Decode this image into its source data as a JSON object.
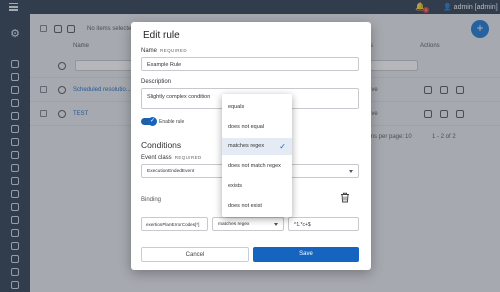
{
  "topbar": {
    "user_label": "admin [admin]",
    "notification_count": "1"
  },
  "background": {
    "selection_text": "No items selected",
    "col_name": "Name",
    "col_actions": "Actions",
    "col_partial": "s",
    "rows": [
      {
        "name": "Scheduled resolutio...",
        "partial": "ive"
      },
      {
        "name": "TEST",
        "partial": "ive"
      }
    ],
    "pagination": {
      "per_page_label": "ms per page:",
      "per_page": "10",
      "range": "1 - 2 of 2"
    }
  },
  "dialog": {
    "title": "Edit rule",
    "name_label": "Name",
    "required_tag": "REQUIRED",
    "name_value": "Example Rule",
    "description_label": "Description",
    "description_value": "Slightly complex condition",
    "enable_label": "Enable rule",
    "conditions_title": "Conditions",
    "event_class_label": "Event class",
    "event_class_value": "ExecutionEndedEvent",
    "binding_label": "Binding",
    "binding_field": "exertionPlanErrorCodes[*]",
    "operator_value": "matches regex",
    "regex_value": "^1.*c+$",
    "cancel_label": "Cancel",
    "save_label": "Save"
  },
  "operator_menu": {
    "options": [
      "equals",
      "does not equal",
      "matches regex",
      "does not match regex",
      "exists",
      "does not exist"
    ],
    "selected_index": 2
  },
  "colors": {
    "primary": "#1565c0",
    "sidebar": "#2b3a4d",
    "badge": "#e53935"
  }
}
